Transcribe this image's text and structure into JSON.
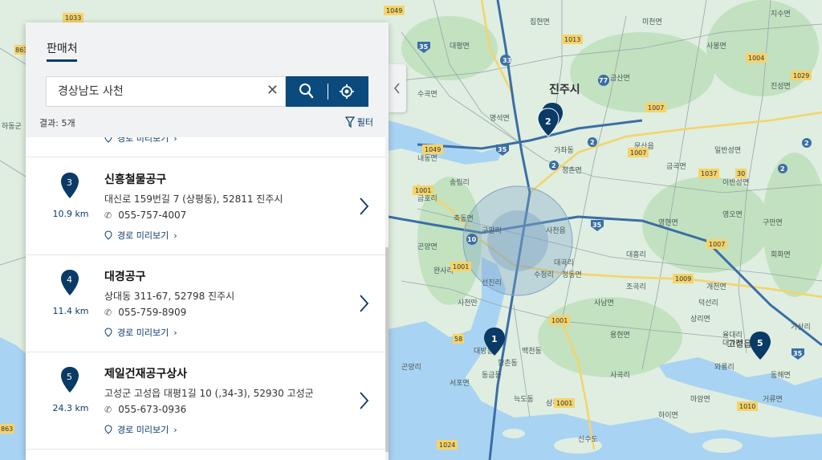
{
  "panel": {
    "tab_label": "판매처",
    "search": {
      "value": "경상남도 사천",
      "placeholder": ""
    },
    "results_label": "결과: 5개",
    "filter_label": "필터",
    "partial_route_label": "경로 미리보기",
    "dealers": [
      {
        "number": "3",
        "distance": "10.9 km",
        "name": "신흥철물공구",
        "address": "대신로 159번길 7 (상평동), 52811 진주시",
        "phone": "055-757-4007",
        "route_label": "경로 미리보기"
      },
      {
        "number": "4",
        "distance": "11.4 km",
        "name": "대경공구",
        "address": "상대동 311-67, 52798 진주시",
        "phone": "055-759-8909",
        "route_label": "경로 미리보기"
      },
      {
        "number": "5",
        "distance": "24.3 km",
        "name": "제일건재공구상사",
        "address": "고성군 고성읍 대평1길 10 (,34-3), 52930 고성군",
        "phone": "055-673-0936",
        "route_label": "경로 미리보기"
      }
    ]
  },
  "map": {
    "city_label": "진주시",
    "markers": [
      "1",
      "2",
      "5"
    ],
    "place_labels": [
      "사천읍",
      "축동면",
      "곤양면",
      "곤명면",
      "완사리",
      "정동면",
      "사남면",
      "용현면",
      "수청리",
      "선진리",
      "대곡리",
      "문산읍",
      "금곡면",
      "개천면",
      "영현면",
      "영오면",
      "구만면",
      "회화면",
      "마암면",
      "고성읍",
      "대가면",
      "상리면",
      "하이면",
      "삼천포",
      "신수도",
      "늑도동",
      "대방동",
      "향촌동",
      "백천동",
      "동금동",
      "서포면",
      "곤양리",
      "하동군",
      "정촌면",
      "명석면",
      "수곡면",
      "대평면",
      "집현면",
      "미천면",
      "일반성면",
      "이반성면",
      "사봉면",
      "지수면",
      "진성면",
      "금산면",
      "내동면",
      "송림리",
      "대흥리",
      "조곡리",
      "가좌동",
      "금호리",
      "와룡리",
      "사곡리",
      "거류면",
      "동해면",
      "거산리",
      "율대리",
      "덕선리"
    ],
    "route_shields": [
      "35",
      "33",
      "2",
      "10",
      "1013",
      "1049",
      "1007",
      "1037",
      "30",
      "1001",
      "1009",
      "1010",
      "1024",
      "58",
      "1004",
      "1029",
      "863",
      "1033",
      "77"
    ],
    "colors": {
      "water": "#a9d3f2",
      "land": "#dfeee0",
      "forest": "#b9dcb8",
      "marker": "#0a3a66",
      "highway": "#3b6ea5",
      "circle": "#7fa6c9"
    }
  },
  "icons": [
    "search-icon",
    "locate-icon",
    "clear-icon",
    "filter-icon",
    "phone-icon",
    "pin-icon",
    "chevron-right-icon",
    "chevron-left-icon"
  ]
}
